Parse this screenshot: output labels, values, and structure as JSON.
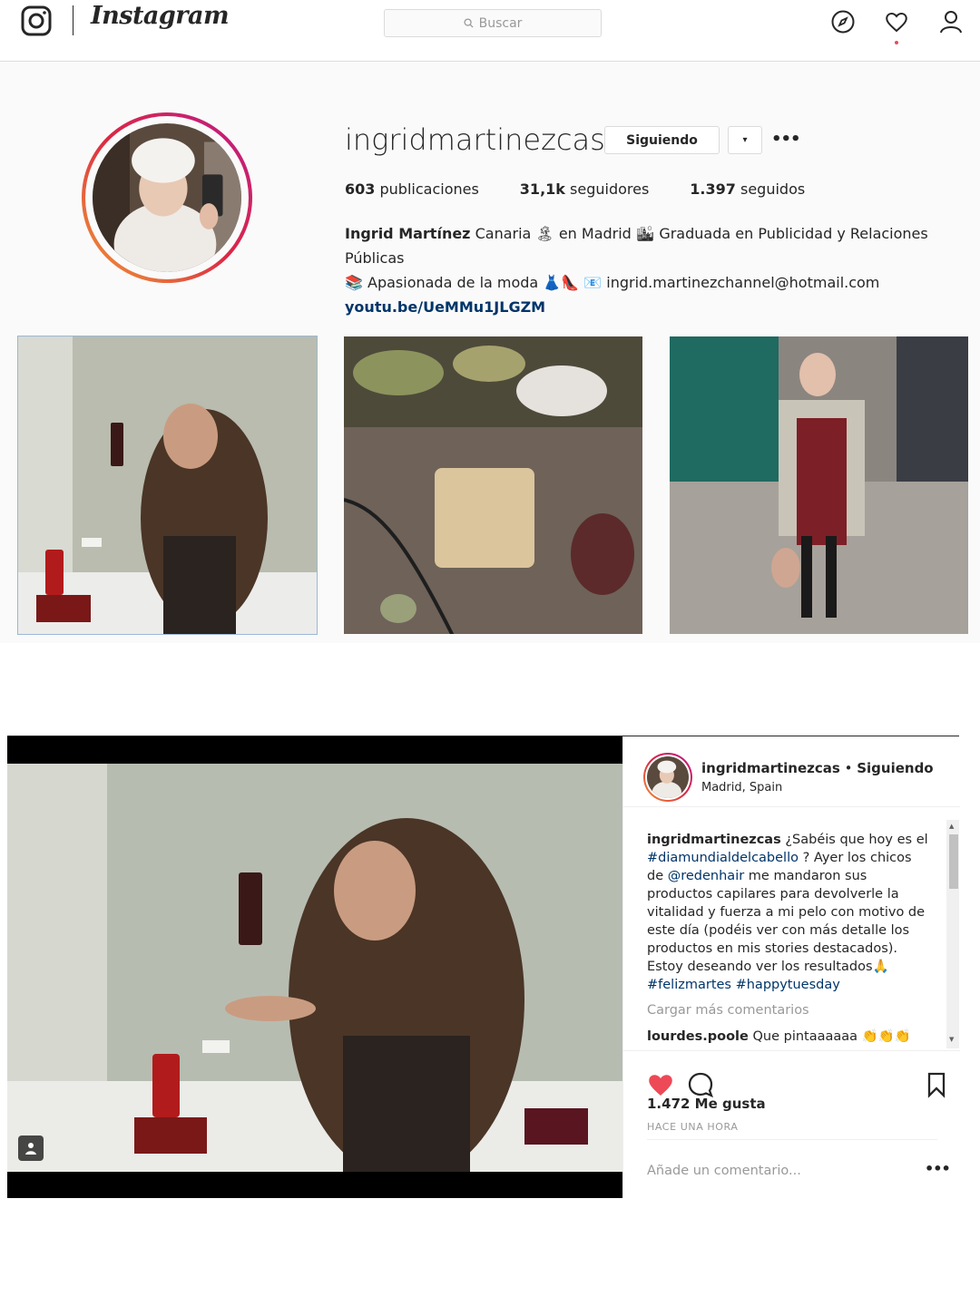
{
  "nav": {
    "wordmark": "Instagram",
    "search_placeholder": "Buscar",
    "icons": [
      "instagram-glyph-icon",
      "search-icon",
      "compass-icon",
      "heart-icon",
      "user-icon"
    ]
  },
  "profile": {
    "username": "ingridmartinezcas",
    "following_label": "Siguiendo",
    "dropdown_symbol": "▾",
    "more_symbol": "•••",
    "stats": {
      "posts_count": "603",
      "posts_label": "publicaciones",
      "followers_count": "31,1k",
      "followers_label": "seguidores",
      "following_count": "1.397",
      "following_label": "seguidos"
    },
    "bio": {
      "full_name": "Ingrid Martínez",
      "line1_rest": " Canaria 🏝 en Madrid 🏙 Graduada en Publicidad y Relaciones Públicas",
      "line2": "📚 Apasionada de la moda 👗👠 📧 ingrid.martinezchannel@hotmail.com",
      "link": "youtu.be/UeMMu1JLGZM"
    }
  },
  "post": {
    "username": "ingridmartinezcas",
    "separator": " • ",
    "follow_state": "Siguiendo",
    "location": "Madrid, Spain",
    "caption": {
      "user": "ingridmartinezcas",
      "text1": " ¿Sabéis que hoy es el ",
      "hashtag1": "#diamundialdelcabello",
      "text2": " ? Ayer los chicos de ",
      "mention": "@redenhair",
      "text3": " me mandaron sus productos capilares para devolverle la vitalidad y fuerza a mi pelo con motivo de este día (podéis ver con más detalle los productos en mis stories destacados). Estoy deseando ver los resultados🙏",
      "hashtag2": "#felizmartes",
      "hashtag3": "#happytuesday"
    },
    "load_more": "Cargar más comentarios",
    "comment": {
      "user": "lourdes.poole",
      "text": " Que pintaaaaaa 👏👏👏"
    },
    "likes": "1.472 Me gusta",
    "time_ago": "HACE UNA HORA",
    "add_comment_placeholder": "Añade un comentario...",
    "options_symbol": "•••",
    "liked": true,
    "colors": {
      "like_red": "#ed4956",
      "link_blue": "#003569"
    }
  }
}
